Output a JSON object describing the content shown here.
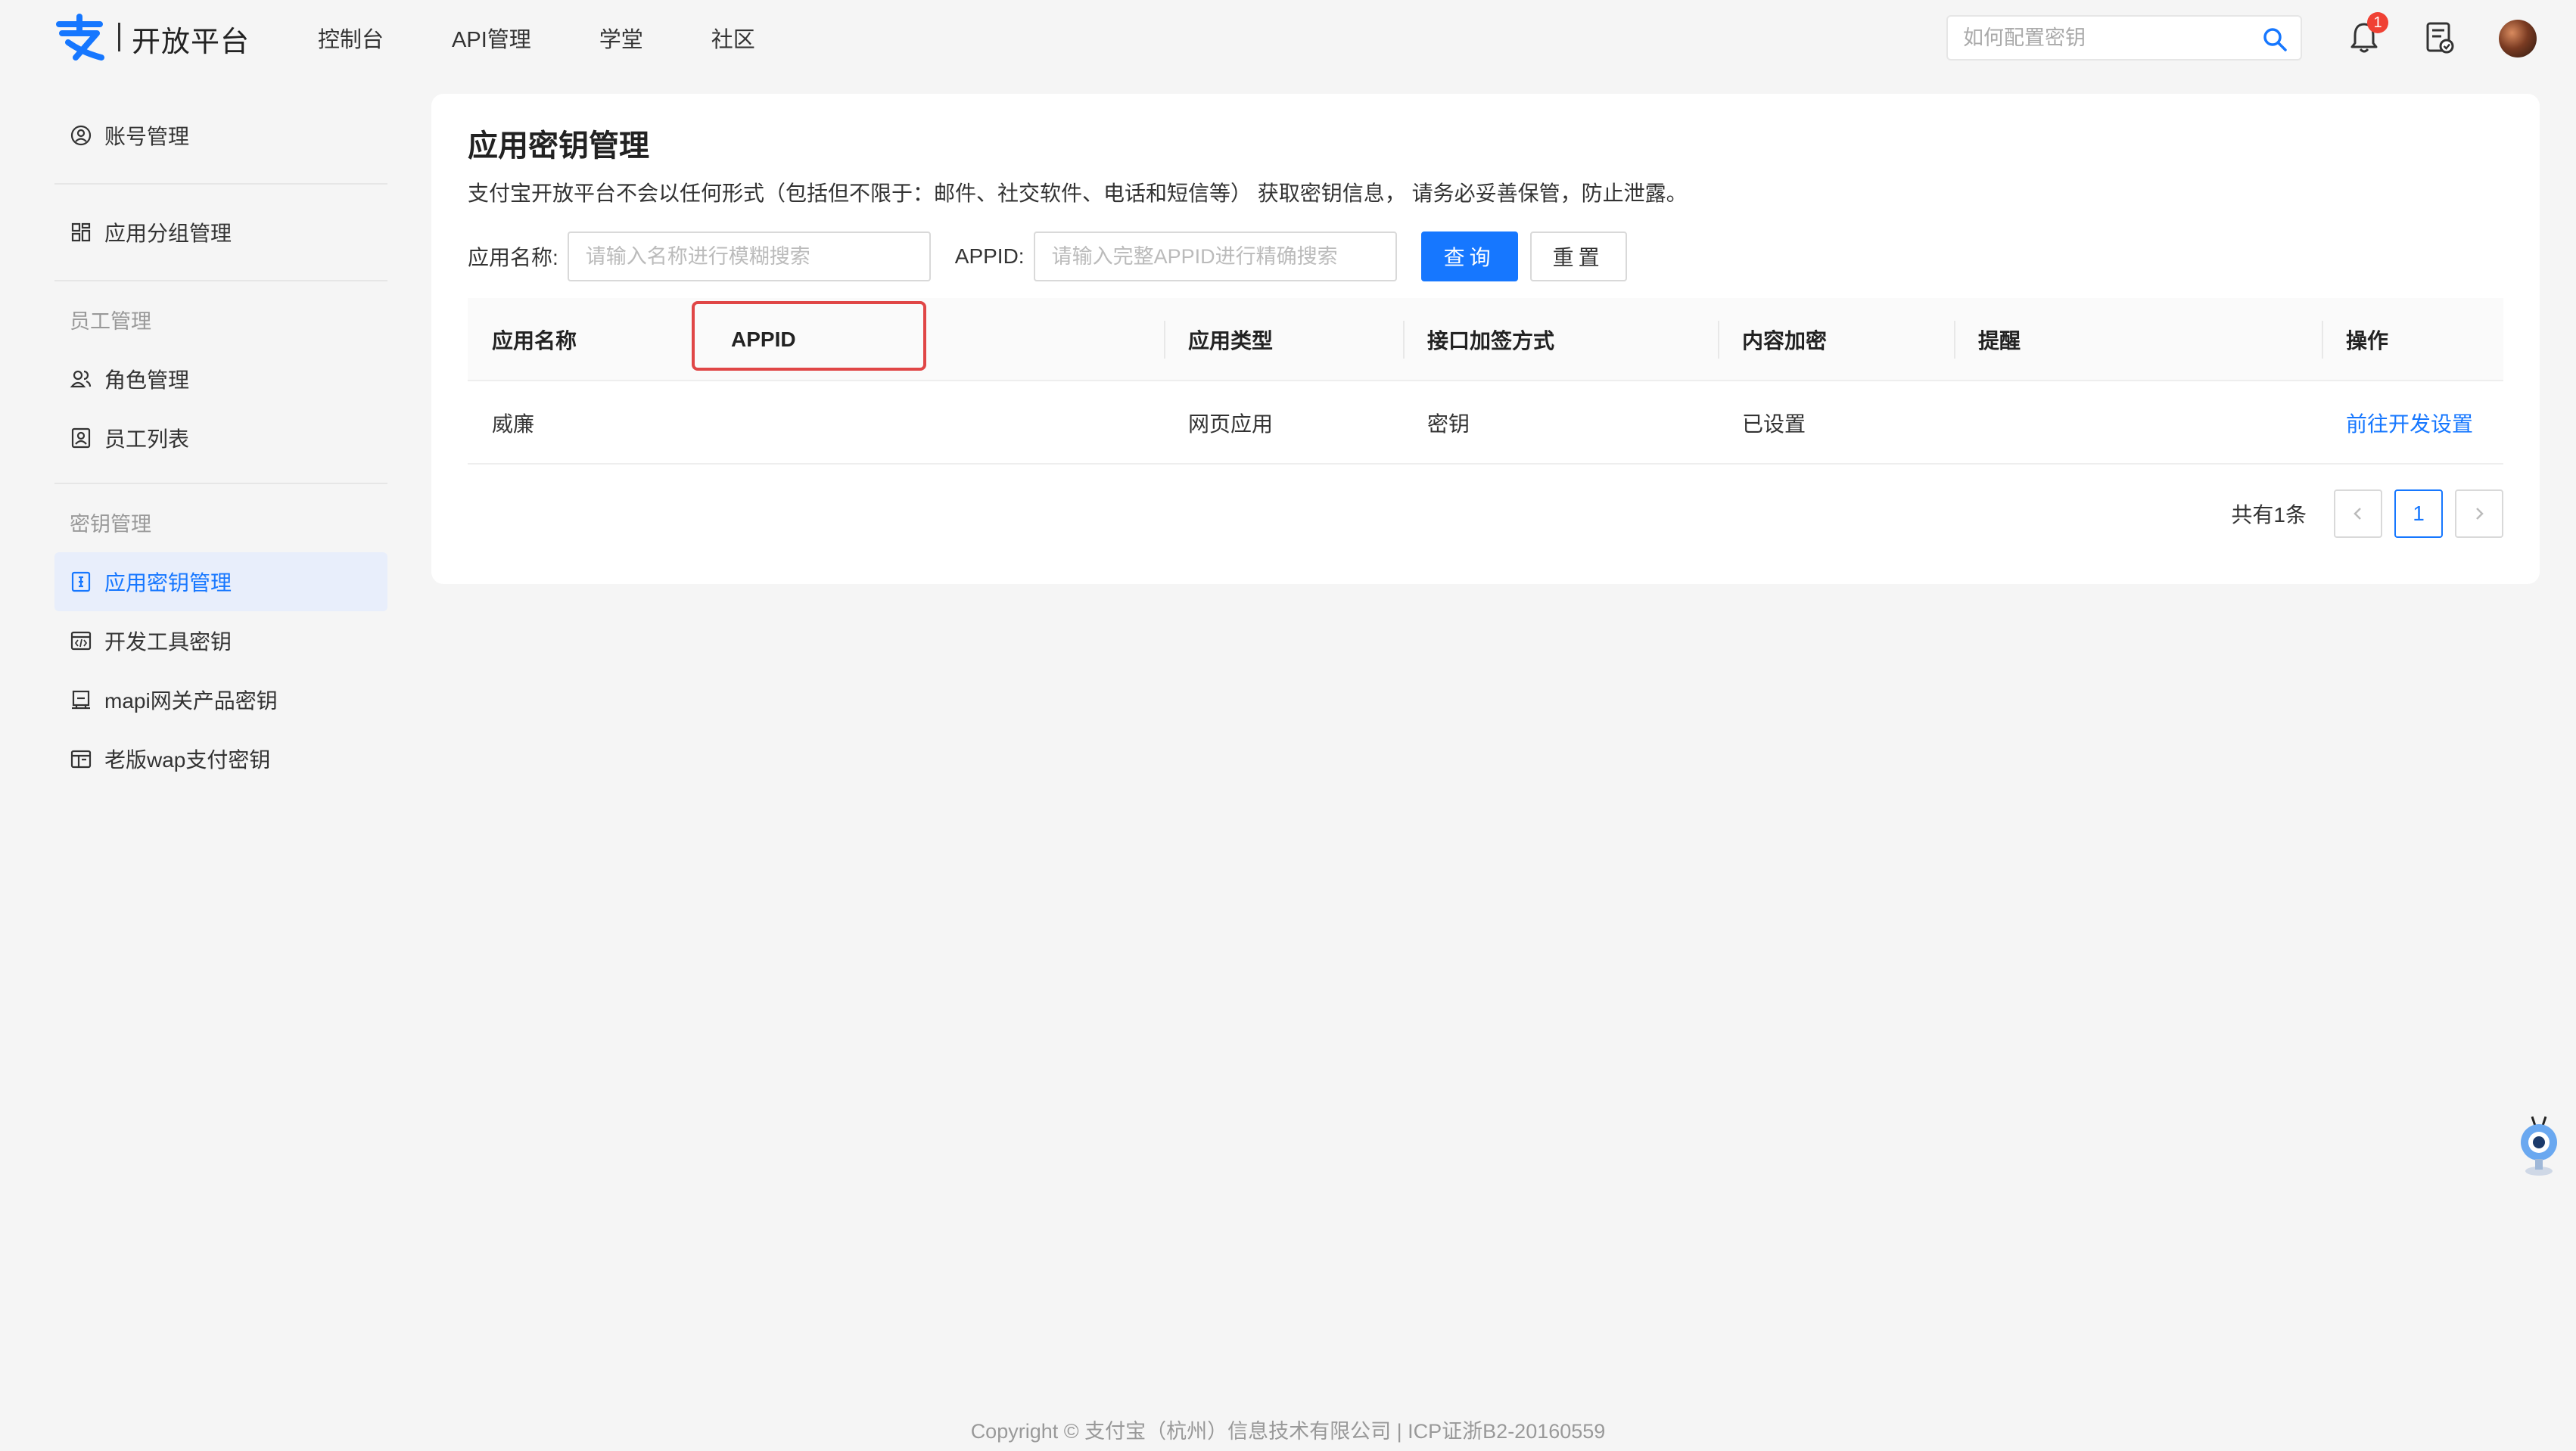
{
  "header": {
    "logo_text": "开放平台",
    "nav": [
      "控制台",
      "API管理",
      "学堂",
      "社区"
    ],
    "search_placeholder": "如何配置密钥",
    "notification_count": "1",
    "icons": [
      "alipay-logo-icon",
      "search-icon",
      "bell-icon",
      "document-icon",
      "avatar"
    ]
  },
  "sidebar": {
    "top_items": [
      {
        "label": "账号管理",
        "icon": "user-circle-icon"
      },
      {
        "label": "应用分组管理",
        "icon": "grid-icon"
      }
    ],
    "group_staff": "员工管理",
    "staff_items": [
      {
        "label": "角色管理",
        "icon": "users-icon"
      },
      {
        "label": "员工列表",
        "icon": "id-card-icon"
      }
    ],
    "group_keys": "密钥管理",
    "key_items": [
      {
        "label": "应用密钥管理",
        "icon": "key-doc-icon",
        "active": true
      },
      {
        "label": "开发工具密钥",
        "icon": "code-icon"
      },
      {
        "label": "mapi网关产品密钥",
        "icon": "book-icon"
      },
      {
        "label": "老版wap支付密钥",
        "icon": "calendar-icon"
      }
    ]
  },
  "main": {
    "title": "应用密钥管理",
    "notice": "支付宝开放平台不会以任何形式（包括但不限于：邮件、社交软件、电话和短信等） 获取密钥信息， 请务必妥善保管，防止泄露。",
    "filters": {
      "name_label": "应用名称:",
      "name_placeholder": "请输入名称进行模糊搜索",
      "appid_label": "APPID:",
      "appid_placeholder": "请输入完整APPID进行精确搜索",
      "query_button": "查询",
      "reset_button": "重置"
    },
    "table": {
      "headers": [
        "应用名称",
        "APPID",
        "应用类型",
        "接口加签方式",
        "内容加密",
        "提醒",
        "操作"
      ],
      "rows": [
        {
          "name": "威廉",
          "appid": "",
          "type": "网页应用",
          "sign": "密钥",
          "encrypt": "已设置",
          "remind": "",
          "action": "前往开发设置"
        }
      ]
    },
    "pagination": {
      "total": "共有1条",
      "current_page": "1",
      "prev": "<",
      "next": ">"
    }
  },
  "footer": {
    "text": "Copyright © 支付宝（杭州）信息技术有限公司 | ICP证浙B2-20160559"
  },
  "colors": {
    "primary": "#1677ff",
    "highlight_box": "#e04646",
    "badge": "#f04134",
    "background": "#f5f5f5"
  }
}
